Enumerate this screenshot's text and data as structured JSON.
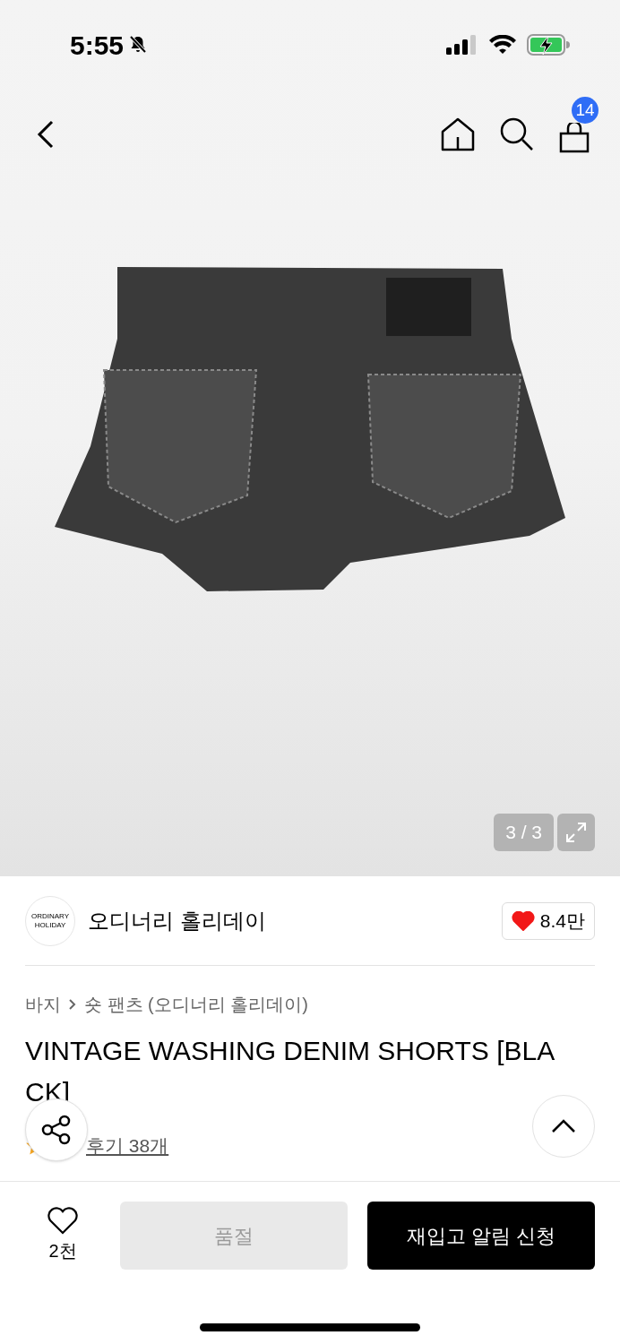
{
  "status_bar": {
    "time": "5:55",
    "silent": true
  },
  "top_nav": {
    "cart_count": "14"
  },
  "gallery": {
    "counter": "3 / 3"
  },
  "brand": {
    "logo_text": "ORDINARY HOLIDAY",
    "name": "오디너리 홀리데이",
    "likes": "8.4만",
    "liked": true
  },
  "breadcrumb": [
    {
      "label": "바지"
    },
    {
      "label": "숏 팬츠 (오디너리 홀리데이)"
    }
  ],
  "product": {
    "title": "VINTAGE WASHING DENIM SHORTS [BLACK]",
    "reviews_link": "후기 38개"
  },
  "bottom_bar": {
    "wish_count": "2천",
    "wished": false,
    "buttons": [
      {
        "kind": "disabled",
        "label": "품절"
      },
      {
        "kind": "primary",
        "label": "재입고 알림 신청"
      }
    ]
  }
}
